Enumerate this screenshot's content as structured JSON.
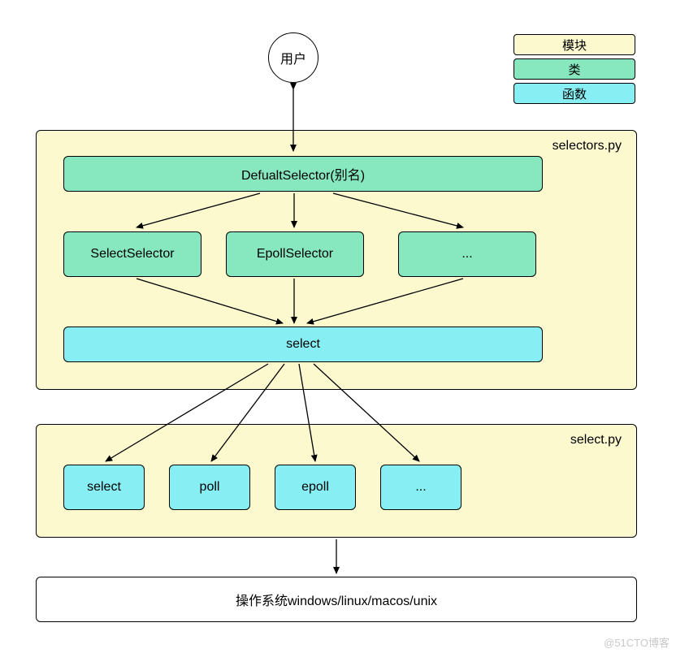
{
  "user_circle": "用户",
  "legend": {
    "module": "模块",
    "class": "类",
    "function": "函数"
  },
  "selectors_module": {
    "filename": "selectors.py",
    "default_selector": "DefualtSelector(别名)",
    "selectors_row": [
      "SelectSelector",
      "EpollSelector",
      "..."
    ],
    "select_fn": "select"
  },
  "select_module": {
    "filename": "select.py",
    "functions": [
      "select",
      "poll",
      "epoll",
      "..."
    ]
  },
  "os_box": "操作系统windows/linux/macos/unix",
  "watermark": "@51CTO博客",
  "colors": {
    "module": "#fcf9cf",
    "class": "#87e8c0",
    "function": "#87eff4"
  }
}
